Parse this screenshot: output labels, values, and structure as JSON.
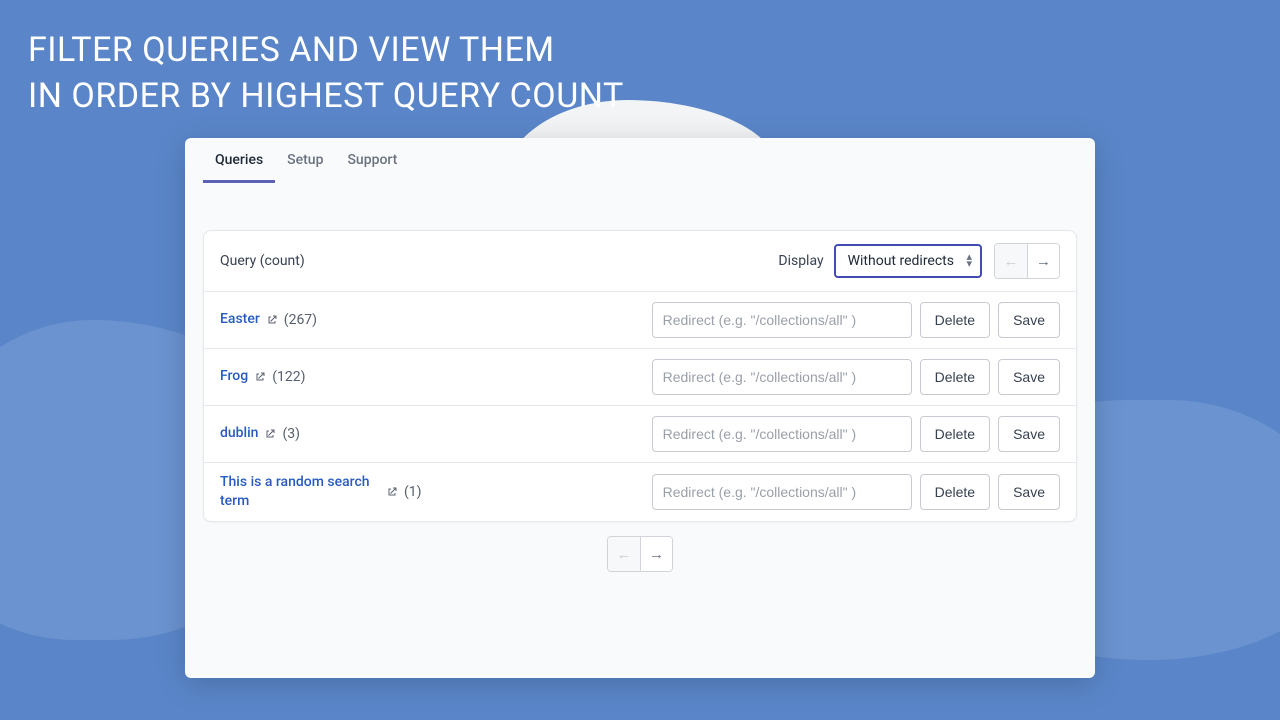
{
  "headline": {
    "line1": "FILTER QUERIES AND VIEW THEM",
    "line2": "IN ORDER BY HIGHEST QUERY COUNT"
  },
  "tabs": {
    "queries": "Queries",
    "setup": "Setup",
    "support": "Support"
  },
  "header": {
    "column_label": "Query (count)",
    "display_label": "Display",
    "display_value": "Without redirects"
  },
  "placeholders": {
    "redirect": "Redirect (e.g. \"/collections/all\" )"
  },
  "buttons": {
    "delete": "Delete",
    "save": "Save"
  },
  "rows": [
    {
      "query": "Easter",
      "count": "(267)"
    },
    {
      "query": "Frog",
      "count": "(122)"
    },
    {
      "query": "dublin",
      "count": "(3)"
    },
    {
      "query": "This is a random search term",
      "count": "(1)"
    }
  ]
}
